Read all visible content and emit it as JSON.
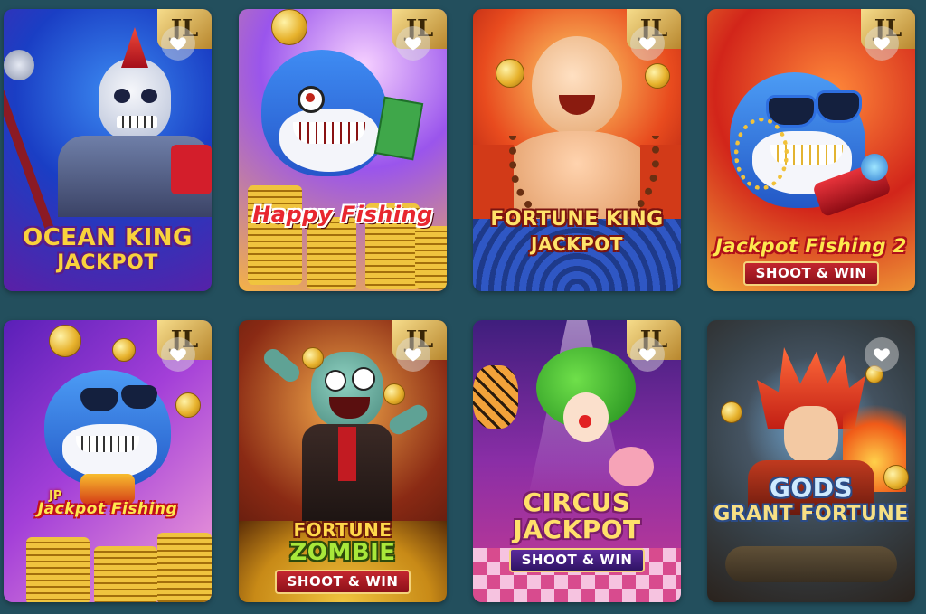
{
  "games": [
    {
      "id": "ocean-king",
      "title_lines": [
        "OCEAN KING",
        "JACKPOT"
      ],
      "provider_badge": "JL",
      "favorite": false,
      "colors": {
        "bg_top": "#1a3ec4",
        "bg_bottom": "#5b1fa6",
        "title": "#f9d23c",
        "title_outline": "#5a1d86"
      }
    },
    {
      "id": "happy-fishing",
      "title_lines": [
        "Happy Fishing"
      ],
      "provider_badge": "JL",
      "favorite": false,
      "colors": {
        "bg_top": "#8a45e6",
        "bg_bottom": "#f8b54a",
        "title": "#e8262f",
        "title_outline": "#ffffff"
      }
    },
    {
      "id": "fortune-king",
      "title_lines": [
        "FORTUNE KING",
        "JACKPOT"
      ],
      "provider_badge": "JL",
      "favorite": false,
      "colors": {
        "bg_top": "#e23b1d",
        "bg_bottom": "#1e3a8a",
        "title": "#ffe36a",
        "title_outline": "#7a1410"
      }
    },
    {
      "id": "jackpot-fishing-2",
      "title_lines": [
        "Jackpot Fishing 2"
      ],
      "sub_banner": "SHOOT & WIN",
      "provider_badge": "JL",
      "favorite": false,
      "colors": {
        "bg_top": "#d2251a",
        "bg_bottom": "#f4a93a",
        "title": "#fde84e",
        "title_outline": "#b0101a"
      }
    },
    {
      "id": "jackpot-fishing",
      "jp_label": "JP",
      "title_lines": [
        "Jackpot Fishing"
      ],
      "provider_badge": "JL",
      "favorite": false,
      "colors": {
        "bg_top": "#8d2fd6",
        "bg_bottom": "#f3a2e0",
        "title": "#fde84e",
        "title_outline": "#c1101c"
      }
    },
    {
      "id": "fortune-zombie",
      "title_lines": [
        "FORTUNE",
        "ZOMBIE"
      ],
      "sub_banner": "SHOOT & WIN",
      "provider_badge": "JL",
      "favorite": false,
      "colors": {
        "bg_top": "#6b1d10",
        "bg_bottom": "#d8912b",
        "title": "#ffd84a",
        "title_outline": "#6a1b0c"
      }
    },
    {
      "id": "circus-jackpot",
      "title_lines": [
        "CIRCUS",
        "JACKPOT"
      ],
      "sub_banner": "SHOOT & WIN",
      "provider_badge": "JL",
      "favorite": false,
      "colors": {
        "bg_top": "#3f1e7d",
        "bg_bottom": "#c83b92",
        "title": "#ffe06a",
        "title_outline": "#7a1d6b"
      }
    },
    {
      "id": "gods-grant-fortune",
      "title_lines": [
        "GODS",
        "GRANT FORTUNE"
      ],
      "favorite": false,
      "colors": {
        "bg_top": "#37424a",
        "bg_bottom": "#4c3a2c",
        "title": "#f7df84",
        "title_outline": "#2b4b86"
      }
    }
  ],
  "icons": {
    "favorite": "heart-icon",
    "provider": "jl-provider-logo"
  }
}
